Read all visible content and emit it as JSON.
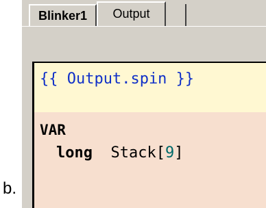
{
  "caption": "b.",
  "tabs": [
    {
      "label": "Blinker1",
      "active": false
    },
    {
      "label": "Output",
      "active": true
    }
  ],
  "editor": {
    "comment": "{{ Output.spin }}",
    "section_keyword": "VAR",
    "declaration": {
      "type_keyword": "long",
      "identifier": "Stack[",
      "size": "9",
      "closing": "]"
    }
  },
  "colors": {
    "comment_background": "#fff8d2",
    "var_background": "#f7dfcf",
    "comment_text": "#1030c8",
    "number_text": "#006a6a"
  }
}
